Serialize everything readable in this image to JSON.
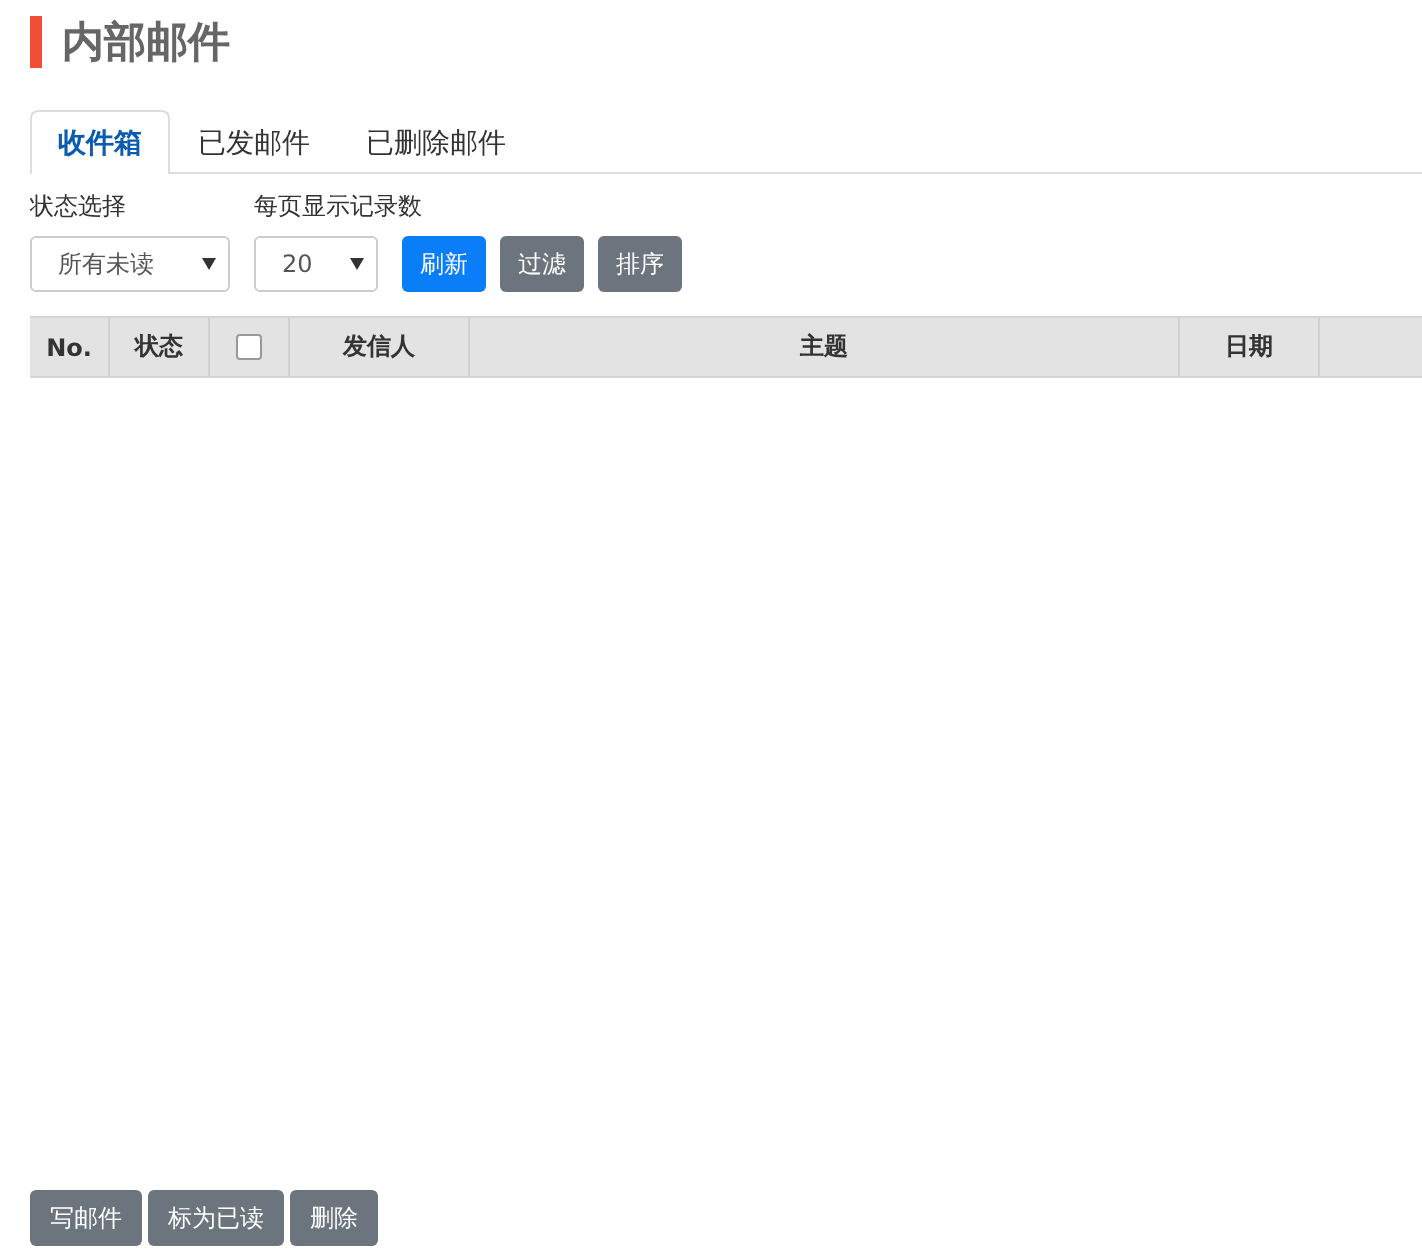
{
  "page_title": "内部邮件",
  "tabs": [
    {
      "label": "收件箱",
      "selected": true
    },
    {
      "label": "已发邮件",
      "selected": false
    },
    {
      "label": "已删除邮件",
      "selected": false
    }
  ],
  "filters": [
    {
      "label": "状态选择",
      "value": "所有未读"
    },
    {
      "label": "每页显示记录数",
      "value": "20"
    }
  ],
  "toolbar_buttons": [
    {
      "label": "刷新",
      "kind": "primary"
    },
    {
      "label": "过滤",
      "kind": "secondary"
    },
    {
      "label": "排序",
      "kind": "secondary"
    }
  ],
  "table": {
    "select_all_checked": false,
    "columns": [
      {
        "label": "No.",
        "kind": "text"
      },
      {
        "label": "状态",
        "kind": "text"
      },
      {
        "kind": "checkbox"
      },
      {
        "label": "发信人",
        "kind": "text"
      },
      {
        "label": "主题",
        "kind": "text"
      },
      {
        "label": "日期",
        "kind": "text"
      },
      {
        "kind": "empty"
      }
    ]
  },
  "bottom_buttons": [
    "写邮件",
    "标为已读",
    "删除"
  ]
}
